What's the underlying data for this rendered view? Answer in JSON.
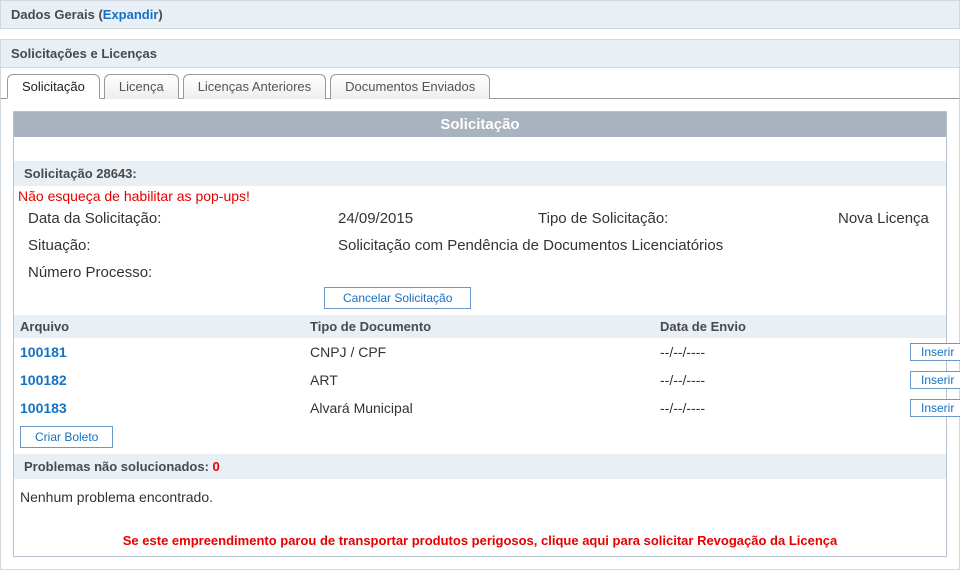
{
  "generalData": {
    "label": "Dados Gerais",
    "expand": "Expandir"
  },
  "sectionTitle": "Solicitações e Licenças",
  "tabs": {
    "solicitacao": "Solicitação",
    "licenca": "Licença",
    "licencasAnteriores": "Licenças Anteriores",
    "documentosEnviados": "Documentos Enviados"
  },
  "inner": {
    "title": "Solicitação",
    "subHeader": "Solicitação 28643:",
    "popupWarning": "Não esqueça de habilitar as pop-ups!",
    "labels": {
      "dataSolicitacao": "Data da Solicitação:",
      "tipoSolicitacao": "Tipo de Solicitação:",
      "situacao": "Situação:",
      "numeroProcesso": "Número Processo:"
    },
    "values": {
      "dataSolicitacao": "24/09/2015",
      "tipoSolicitacao": "Nova Licença",
      "situacao": "Solicitação com Pendência de Documentos Licenciatórios",
      "numeroProcesso": ""
    },
    "cancelBtn": "Cancelar Solicitação"
  },
  "tableHeaders": {
    "arquivo": "Arquivo",
    "tipoDocumento": "Tipo de Documento",
    "dataEnvio": "Data de Envio"
  },
  "rows": [
    {
      "arquivo": "100181",
      "tipo": "CNPJ / CPF",
      "data": "--/--/----",
      "inserir": "Inserir"
    },
    {
      "arquivo": "100182",
      "tipo": "ART",
      "data": "--/--/----",
      "inserir": "Inserir"
    },
    {
      "arquivo": "100183",
      "tipo": "Alvará Municipal",
      "data": "--/--/----",
      "inserir": "Inserir"
    }
  ],
  "criarBoleto": "Criar Boleto",
  "problems": {
    "label": "Problemas não solucionados: ",
    "count": "0",
    "none": "Nenhum problema encontrado."
  },
  "footerWarning": "Se este empreendimento parou de transportar produtos perigosos, clique aqui para solicitar Revogação da Licença"
}
